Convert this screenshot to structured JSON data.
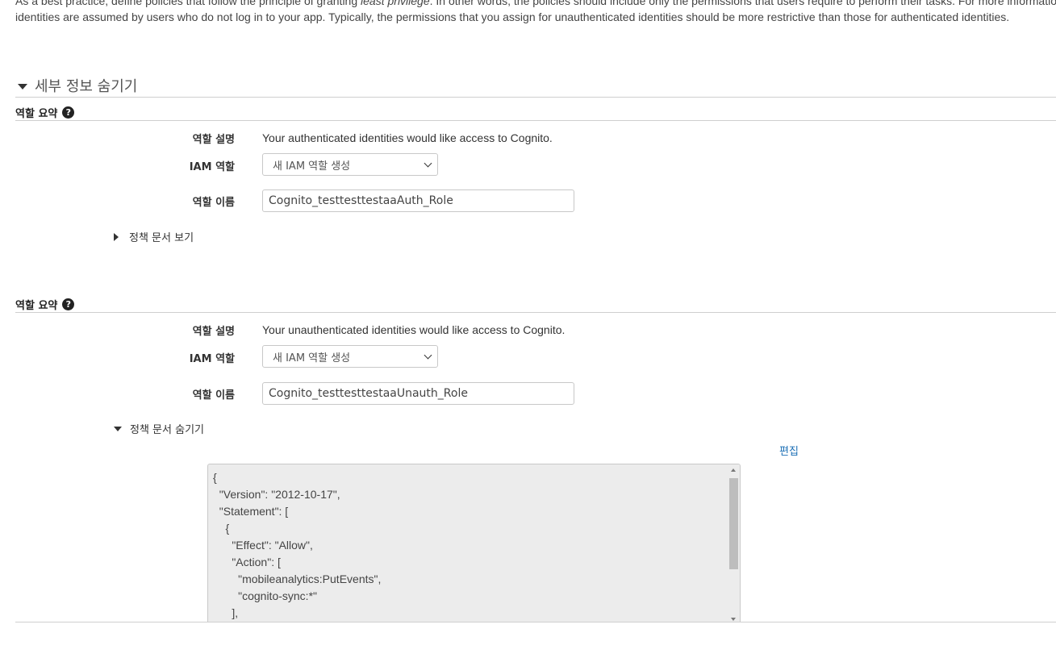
{
  "intro": {
    "line1_start": "As a best practice, define policies that follow the principle of granting ",
    "line1_em": "least privilege",
    "line1_end": ". In other words, the policies should include only the permissions that users require to perform their tasks. For more information",
    "line2": "identities are assumed by users who do not log in to your app. Typically, the permissions that you assign for unauthenticated identities should be more restrictive than those for authenticated identities."
  },
  "details": {
    "title": "세부 정보 숨기기"
  },
  "auth_role": {
    "summary_label": "역할 요약",
    "description_label": "역할 설명",
    "description_value": "Your authenticated identities would like access to Cognito.",
    "iam_role_label": "IAM 역할",
    "iam_role_selected": "새 IAM 역할 생성",
    "role_name_label": "역할 이름",
    "role_name_value": "Cognito_testtesttestaaAuth_Role",
    "policy_toggle": "정책 문서 보기"
  },
  "unauth_role": {
    "summary_label": "역할 요약",
    "description_label": "역할 설명",
    "description_value": "Your unauthenticated identities would like access to Cognito.",
    "iam_role_label": "IAM 역할",
    "iam_role_selected": "새 IAM 역할 생성",
    "role_name_label": "역할 이름",
    "role_name_value": "Cognito_testtesttestaaUnauth_Role",
    "policy_toggle": "정책 문서 숨기기",
    "edit_label": "편집",
    "policy_document": "{\n  \"Version\": \"2012-10-17\",\n  \"Statement\": [\n    {\n      \"Effect\": \"Allow\",\n      \"Action\": [\n        \"mobileanalytics:PutEvents\",\n        \"cognito-sync:*\"\n      ],"
  },
  "help_icon_glyph": "?",
  "icons": {
    "help": "help-circle-icon",
    "expand": "caret-right-icon",
    "collapse": "caret-down-icon"
  },
  "colors": {
    "link": "#1a6eb5",
    "policy_bg": "#ececec"
  }
}
